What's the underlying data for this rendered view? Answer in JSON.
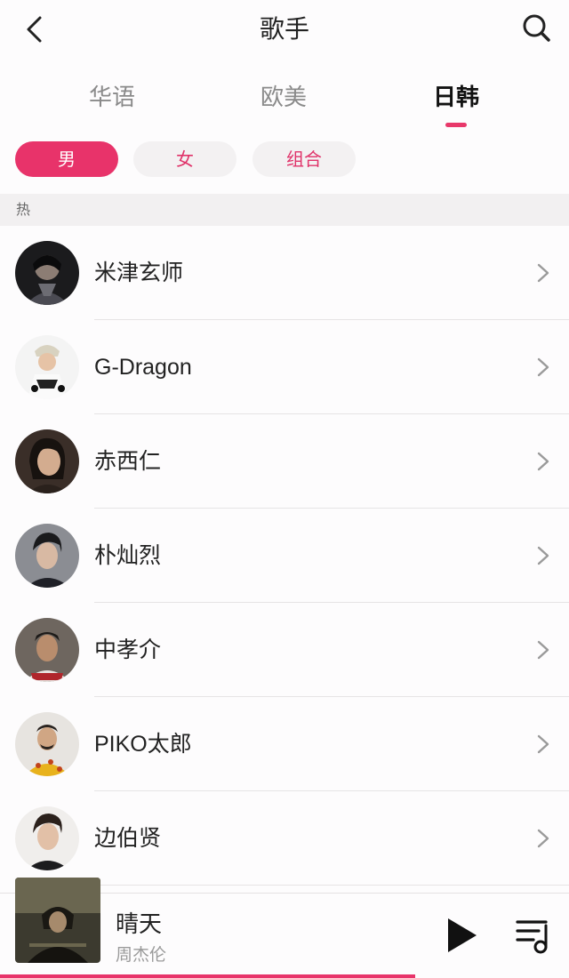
{
  "header": {
    "title": "歌手"
  },
  "tabs": [
    {
      "label": "华语"
    },
    {
      "label": "欧美"
    },
    {
      "label": "日韩"
    }
  ],
  "active_tab": 2,
  "chips": [
    {
      "label": "男"
    },
    {
      "label": "女"
    },
    {
      "label": "组合"
    }
  ],
  "active_chip": 0,
  "section": {
    "label": "热"
  },
  "artists": [
    {
      "name": "米津玄师"
    },
    {
      "name": "G-Dragon"
    },
    {
      "name": "赤西仁"
    },
    {
      "name": "朴灿烈"
    },
    {
      "name": "中孝介"
    },
    {
      "name": "PIKO太郎"
    },
    {
      "name": "边伯贤"
    }
  ],
  "player": {
    "song": "晴天",
    "artist": "周杰伦",
    "progress_percent": 73
  },
  "colors": {
    "accent": "#e8336a",
    "background": "#fdfcfd",
    "section_bg": "#f2f0f1"
  },
  "icons": {
    "back": "chevron-left-icon",
    "search": "search-icon",
    "row_arrow": "chevron-right-icon",
    "play": "play-icon",
    "playlist": "playlist-icon"
  }
}
